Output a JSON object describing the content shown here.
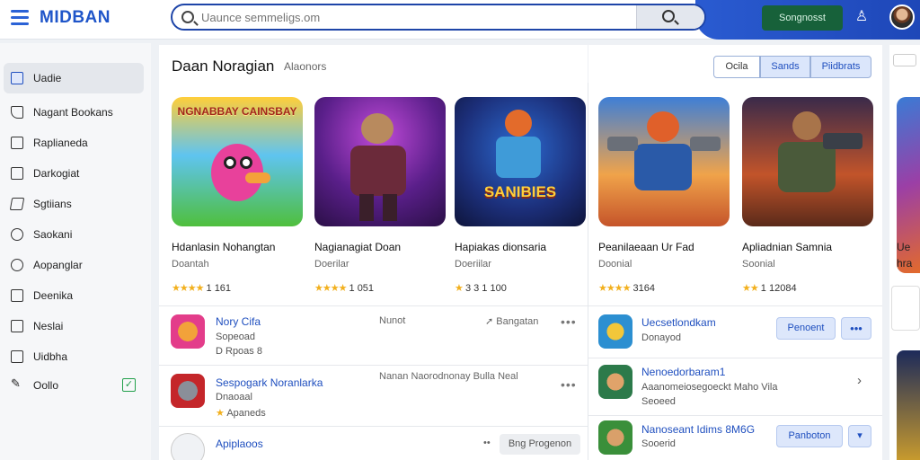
{
  "header": {
    "brand": "MIDBAN",
    "search_placeholder": "Uaunce semmeligs.om",
    "cta_label": "Songnosst",
    "colors": {
      "brand": "#1f55c9",
      "header_accent": "#2a5bd1",
      "cta_bg": "#17613a"
    }
  },
  "sidebar": {
    "items": [
      {
        "label": "Uadie",
        "icon": "home-icon",
        "active": true
      },
      {
        "label": "Nagant Bookans",
        "icon": "tag-icon"
      },
      {
        "label": "Raplianeda",
        "icon": "bag-icon"
      },
      {
        "label": "Darkogiat",
        "icon": "box-icon"
      },
      {
        "label": "Sgtiians",
        "icon": "triangle-icon"
      },
      {
        "label": "Saokani",
        "icon": "circle-icon"
      },
      {
        "label": "Aopanglar",
        "icon": "at-icon"
      },
      {
        "label": "Deenika",
        "icon": "screen-icon"
      },
      {
        "label": "Neslai",
        "icon": "news-icon"
      },
      {
        "label": "Uidbha",
        "icon": "book-icon"
      },
      {
        "label": "Oollo",
        "icon": "pen-icon"
      }
    ]
  },
  "main": {
    "title": "Daan Noragian",
    "subtitle": "Alaonors",
    "segments": [
      "Ocila",
      "Sands",
      "Piidbrats"
    ],
    "cards": [
      {
        "title": "Hdanlasin Nohangtan",
        "dev": "Doantah",
        "rating": "1 161",
        "stars": "★★★★",
        "art_text": "NGNABBAY CAINSBAY"
      },
      {
        "title": "Nagianagiat Doan",
        "dev": "Doerilar",
        "rating": "1 051",
        "stars": "★★★★"
      },
      {
        "title": "Hapiakas dionsaria",
        "dev": "Doeriilar",
        "rating": "3 3 1 100",
        "stars": "★",
        "art_text": "SANIBIES"
      },
      {
        "title": "Peanilaeaan Ur Fad",
        "dev": "Doonial",
        "rating": "3164",
        "stars": "★★★★"
      },
      {
        "title": "Apliadnian Samnia",
        "dev": "Soonial",
        "rating": "1 12084",
        "stars": "★★"
      }
    ],
    "list_left": [
      {
        "title": "Nory Cifa",
        "sub1": "Sopeoad",
        "sub2": "D Rpoas 8",
        "meta": "Nunot",
        "meta2": "Bangatan"
      },
      {
        "title": "Sespogark Noranlarka",
        "sub1": "Dnaoaal",
        "sub2": "Apaneds",
        "meta": "Nanan Naorodnonay Bulla Neal"
      },
      {
        "title": "Apiplaoos",
        "meta2": "Bng Progenon"
      }
    ],
    "list_right": [
      {
        "title": "Uecsetlondkam",
        "sub1": "Donayod",
        "button": "Penoent"
      },
      {
        "title": "Nenoedorbaram1",
        "sub1": "Aaanomeiosegoeckt Maho Vila",
        "sub2": "Seoeed"
      },
      {
        "title": "Nanoseant Idims 8M6G",
        "sub1": "Sooerid",
        "button": "Panboton"
      }
    ],
    "right_strip": {
      "t1": "Ue",
      "t2": "hra"
    }
  }
}
